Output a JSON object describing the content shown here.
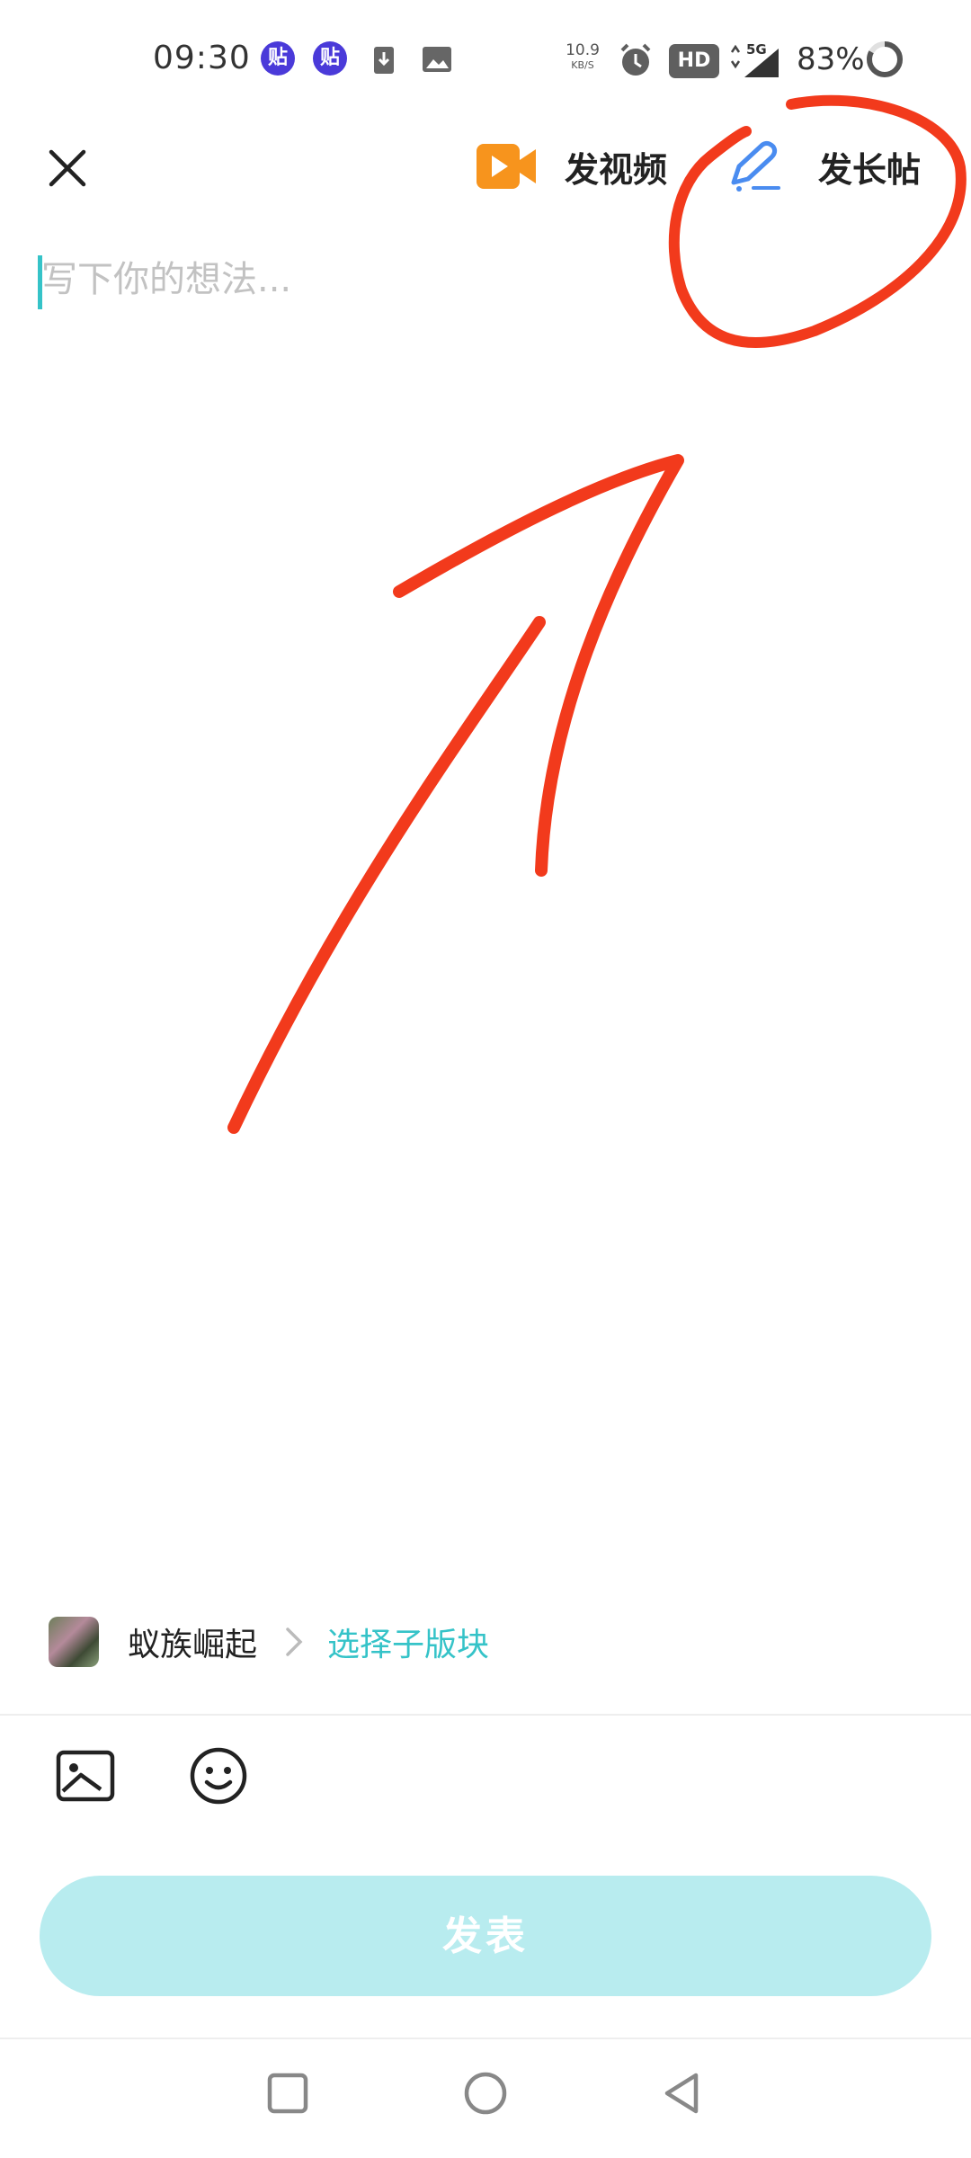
{
  "status_bar": {
    "time": "09:30",
    "app_badge_1": "贴",
    "app_badge_2": "贴",
    "net_speed_value": "10.9",
    "net_speed_unit": "KB/S",
    "hd_label": "HD",
    "network_label": "5G",
    "battery_percent": "83%"
  },
  "top_bar": {
    "video_label": "发视频",
    "long_post_label": "发长帖"
  },
  "compose": {
    "placeholder": "写下你的想法..."
  },
  "forum": {
    "name": "蚁族崛起",
    "sub_board_label": "选择子版块"
  },
  "publish": {
    "label": "发表"
  },
  "colors": {
    "accent": "#35c3c8",
    "publish_disabled": "#b8ecef",
    "video_icon": "#f7941d",
    "pen_icon": "#4a8cf0",
    "annotation_red": "#f23a1c"
  },
  "icons": {
    "close": "close-icon",
    "video": "video-camera-icon",
    "long_post": "pen-icon",
    "image": "image-icon",
    "emoji": "smiley-icon"
  }
}
